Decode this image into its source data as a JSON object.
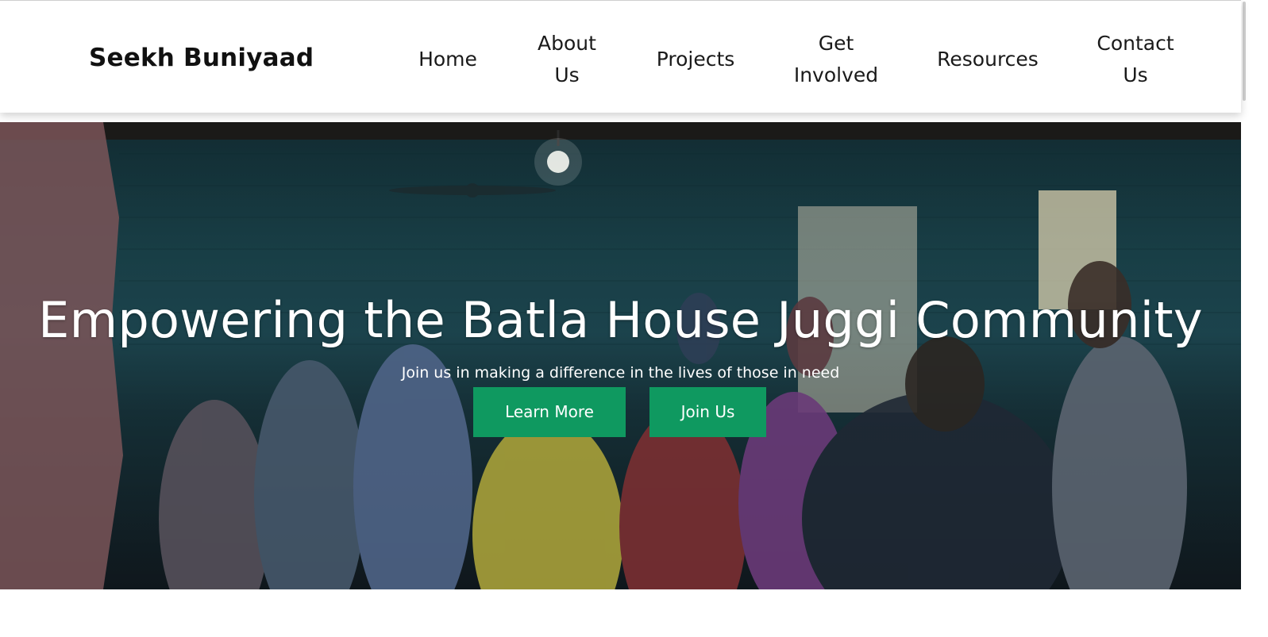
{
  "brand": {
    "name": "Seekh Buniyaad"
  },
  "nav": {
    "items": [
      {
        "lines": [
          "Home"
        ]
      },
      {
        "lines": [
          "About",
          "Us"
        ]
      },
      {
        "lines": [
          "Projects"
        ]
      },
      {
        "lines": [
          "Get",
          "Involved"
        ]
      },
      {
        "lines": [
          "Resources"
        ]
      },
      {
        "lines": [
          "Contact",
          "Us"
        ]
      }
    ]
  },
  "hero": {
    "title": "Empowering the Batla House Juggi Community",
    "subtitle": "Join us in making a difference in the lives of those in need",
    "buttons": {
      "learn_more": "Learn More",
      "join_us": "Join Us"
    },
    "image": "community-gathering-photo"
  },
  "colors": {
    "accent": "#0f9960",
    "navbar_bg": "#ffffff",
    "brand_text": "#111111",
    "hero_overlay": "#000000"
  }
}
